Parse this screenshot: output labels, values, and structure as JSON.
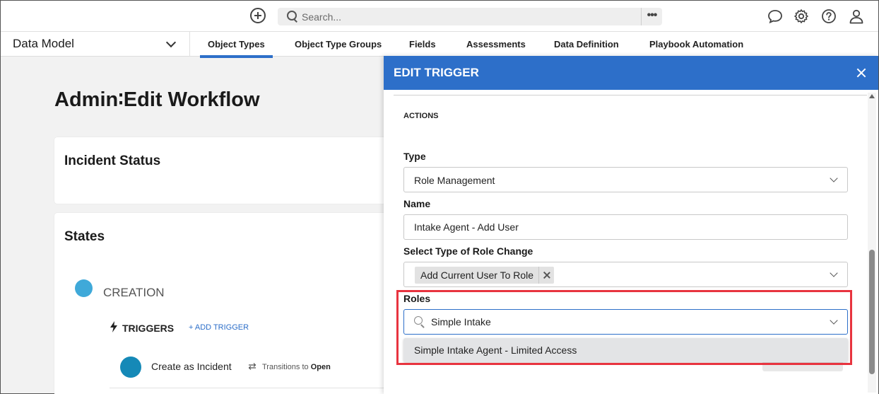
{
  "topbar": {
    "search_placeholder": "Search...",
    "more_label": "•••"
  },
  "nav": {
    "module": "Data Model",
    "tabs": [
      {
        "label": "Object Types",
        "active": true
      },
      {
        "label": "Object Type Groups",
        "active": false
      },
      {
        "label": "Fields",
        "active": false
      },
      {
        "label": "Assessments",
        "active": false
      },
      {
        "label": "Data Definition",
        "active": false
      },
      {
        "label": "Playbook Automation",
        "active": false
      }
    ]
  },
  "main": {
    "page_title": "Admin∶Edit Workflow",
    "status_card_title": "Incident Status",
    "states_card_title": "States",
    "state": {
      "label": "CREATION",
      "triggers_label": "TRIGGERS",
      "add_trigger_label": "+ ADD TRIGGER",
      "trigger": {
        "name": "Create as Incident",
        "transitions_prefix": "Transitions to",
        "transitions_target": "Open"
      }
    }
  },
  "panel": {
    "title": "EDIT TRIGGER",
    "section": "ACTIONS",
    "type_label": "Type",
    "type_value": "Role Management",
    "name_label": "Name",
    "name_value": "Intake Agent - Add User",
    "role_change_label": "Select Type of Role Change",
    "role_change_chip": "Add Current User To Role",
    "roles_label": "Roles",
    "roles_search_value": "Simple Intake",
    "roles_option": "Simple Intake Agent - Limited Access"
  },
  "colors": {
    "accent": "#2d6fc9",
    "highlight": "#e8343f",
    "state_dot": "#3fa9d9",
    "trigger_dot": "#1589b7"
  }
}
